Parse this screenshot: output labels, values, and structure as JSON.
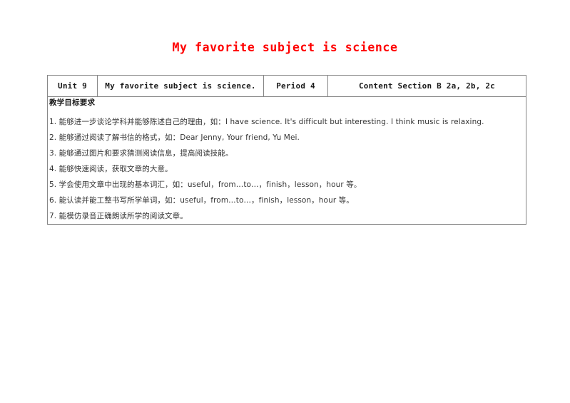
{
  "document": {
    "title": "My favorite subject is science",
    "title_color": "#ff0000"
  },
  "lesson_table": {
    "header": {
      "unit": "Unit 9",
      "topic": "My favorite subject is science.",
      "period": "Period 4",
      "content": "Content  Section B  2a, 2b, 2c"
    },
    "body": {
      "heading": "教学目标要求",
      "objectives": [
        "1. 能够进一步谈论学科并能够陈述自己的理由，如：I have science. It's difficult but interesting. I think music is relaxing.",
        "2. 能够通过阅读了解书信的格式，如：Dear Jenny, Your friend, Yu Mei.",
        "3. 能够通过图片和要求猜测阅读信息，提高阅读技能。",
        "4. 能够快速阅读，获取文章的大意。",
        "5. 学会使用文章中出现的基本词汇，如：useful，from…to…，finish，lesson，hour 等。",
        "6. 能认读并能工整书写所学单词，如：useful，from…to…，finish，lesson，hour 等。",
        "7. 能模仿录音正确朗读所学的阅读文章。"
      ]
    }
  }
}
